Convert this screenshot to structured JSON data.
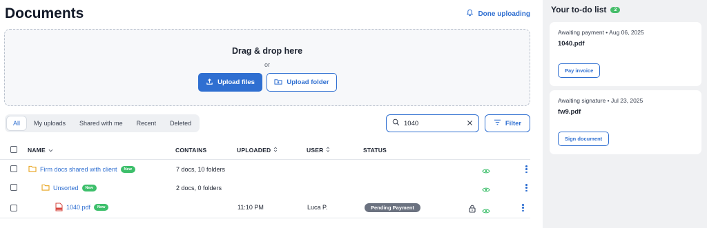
{
  "header": {
    "title": "Documents",
    "done_uploading": "Done uploading"
  },
  "dropzone": {
    "title": "Drag & drop here",
    "or": "or",
    "upload_files": "Upload files",
    "upload_folder": "Upload folder"
  },
  "tabs": [
    {
      "label": "All",
      "active": true
    },
    {
      "label": "My uploads"
    },
    {
      "label": "Shared with me"
    },
    {
      "label": "Recent"
    },
    {
      "label": "Deleted"
    }
  ],
  "search": {
    "value": "1040"
  },
  "filter": {
    "label": "Filter"
  },
  "table": {
    "columns": {
      "name": "NAME",
      "contains": "CONTAINS",
      "uploaded": "UPLOADED",
      "user": "USER",
      "status": "STATUS"
    },
    "rows": [
      {
        "name": "Firm docs shared with client",
        "badge": "New",
        "contains": "7 docs, 10 folders",
        "uploaded": "",
        "user": "",
        "status": ""
      },
      {
        "name": "Unsorted",
        "badge": "New",
        "contains": "2 docs, 0 folders",
        "uploaded": "",
        "user": "",
        "status": ""
      },
      {
        "name": "1040.pdf",
        "badge": "New",
        "contains": "",
        "uploaded": "11:10 PM",
        "user": "Luca P.",
        "status": "Pending Payment"
      }
    ]
  },
  "sidebar": {
    "title": "Your to-do list",
    "count": "2",
    "items": [
      {
        "meta": "Awaiting payment  •  Aug 06, 2025",
        "file": "1040.pdf",
        "action": "Pay invoice"
      },
      {
        "meta": "Awaiting signature  •  Jul 23, 2025",
        "file": "fw9.pdf",
        "action": "Sign document"
      }
    ]
  },
  "colors": {
    "accent": "#2f6fd1",
    "success": "#3dbf6b",
    "status_gray": "#6b7280",
    "sidebar_bg": "#f0f1f3"
  }
}
